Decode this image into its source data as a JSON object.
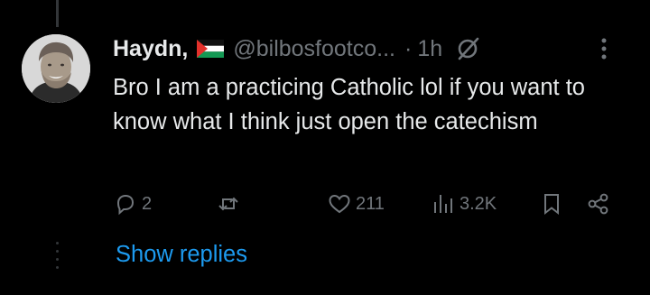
{
  "author": {
    "name": "Haydn,",
    "handle": "@bilbosfootco...",
    "separator": "·",
    "time": "1h"
  },
  "tweet": {
    "text": "Bro I am a practicing Catholic lol if you want to know what I think just open the catechism"
  },
  "actions": {
    "replies": "2",
    "retweets": "",
    "likes": "211",
    "views": "3.2K"
  },
  "show_replies": "Show replies",
  "icons": [
    "flag-icon",
    "grok-icon",
    "more-icon",
    "reply-icon",
    "retweet-icon",
    "like-icon",
    "views-icon",
    "bookmark-icon",
    "share-icon"
  ],
  "colors": {
    "background": "#000000",
    "text": "#e7e9ea",
    "secondary": "#71767b",
    "link": "#1d9bf0",
    "thread_line": "#333639"
  }
}
